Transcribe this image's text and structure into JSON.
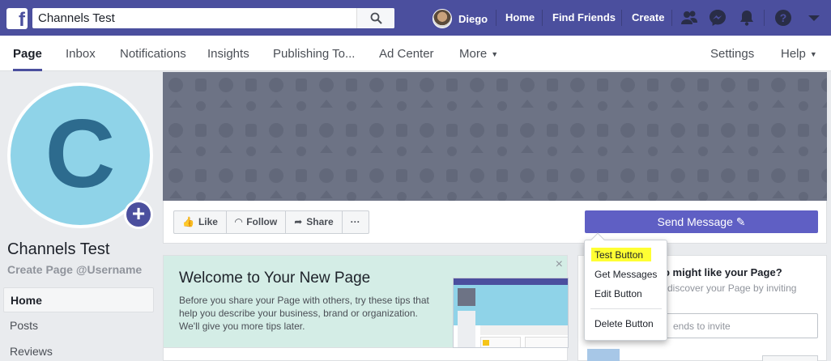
{
  "topbar": {
    "search_value": "Channels Test",
    "user_name": "Diego",
    "links": [
      "Home",
      "Find Friends",
      "Create"
    ],
    "icons": [
      "friends-icon",
      "messenger-icon",
      "notifications-bell-icon",
      "help-icon",
      "account-menu-caret-icon"
    ],
    "brand_color": "#4b4f9e"
  },
  "pagenav": {
    "tabs": [
      "Page",
      "Inbox",
      "Notifications",
      "Insights",
      "Publishing To...",
      "Ad Center",
      "More"
    ],
    "right": [
      "Settings",
      "Help"
    ]
  },
  "profile": {
    "letter": "C",
    "page_name": "Channels Test",
    "username_link": "Create Page @Username",
    "nav": [
      "Home",
      "Posts",
      "Reviews"
    ]
  },
  "actions": {
    "like": "Like",
    "follow": "Follow",
    "share": "Share",
    "more": "···",
    "send_message": "Send Message"
  },
  "dropdown": {
    "items": [
      "Test Button",
      "Get Messages",
      "Edit Button",
      "Delete Button"
    ]
  },
  "welcome": {
    "title": "Welcome to Your New Page",
    "body": "Before you share your Page with others, try these tips that help you describe your business, brand or organization. We'll give you more tips later.",
    "close": "×"
  },
  "invite": {
    "title": "o might like your Page?",
    "subtitle": "discover your Page by inviting",
    "input_placeholder": "ends to invite"
  }
}
